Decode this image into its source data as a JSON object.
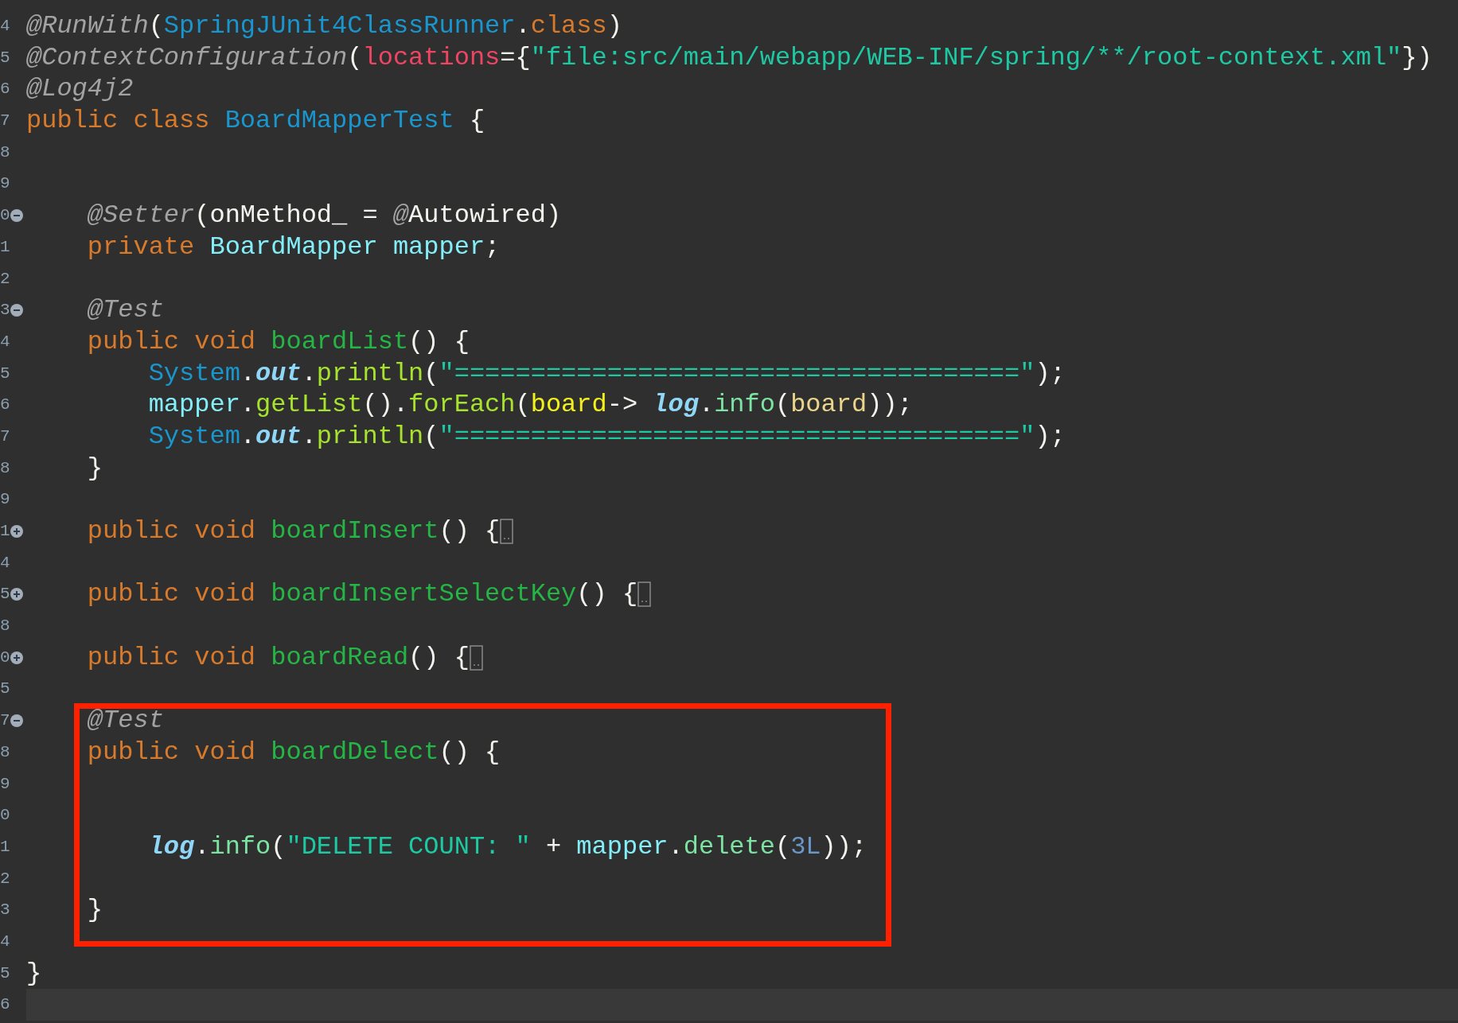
{
  "editor": {
    "sections": [
      {
        "kind": "plain",
        "lines": [
          {
            "number": "4",
            "tokens": [
              {
                "kind": "annotation",
                "text": "@RunWith"
              },
              {
                "kind": "plain",
                "text": "("
              },
              {
                "kind": "class",
                "text": "SpringJUnit4ClassRunner"
              },
              {
                "kind": "plain",
                "text": "."
              },
              {
                "kind": "keyword",
                "text": "class"
              },
              {
                "kind": "plain",
                "text": ")"
              }
            ]
          },
          {
            "number": "5",
            "tokens": [
              {
                "kind": "annotation",
                "text": "@ContextConfiguration"
              },
              {
                "kind": "plain",
                "text": "("
              },
              {
                "kind": "attribute",
                "text": "locations"
              },
              {
                "kind": "plain",
                "text": "={"
              },
              {
                "kind": "string",
                "text": "\"file:src/main/webapp/WEB-INF/spring/**/root-context.xml\""
              },
              {
                "kind": "plain",
                "text": "})"
              }
            ]
          },
          {
            "number": "6",
            "tokens": [
              {
                "kind": "annotation",
                "text": "@Log4j2"
              }
            ]
          },
          {
            "number": "7",
            "tokens": [
              {
                "kind": "keyword",
                "text": "public class "
              },
              {
                "kind": "class",
                "text": "BoardMapperTest "
              },
              {
                "kind": "plain",
                "text": "{"
              }
            ]
          },
          {
            "number": "8"
          },
          {
            "number": "9"
          },
          {
            "number": "0",
            "collapsed": false,
            "tokens": [
              {
                "kind": "annotation",
                "text": "    @Setter"
              },
              {
                "kind": "plain",
                "text": "(onMethod_ = "
              },
              {
                "kind": "annotation",
                "text": "@"
              },
              {
                "kind": "plain",
                "text": "Autowired)"
              }
            ]
          },
          {
            "number": "1",
            "tokens": [
              {
                "kind": "keyword",
                "text": "    private "
              },
              {
                "kind": "field",
                "text": "BoardMapper mapper"
              },
              {
                "kind": "plain",
                "text": ";"
              }
            ]
          },
          {
            "number": "2"
          },
          {
            "number": "3",
            "collapsed": false,
            "tokens": [
              {
                "kind": "annotation",
                "text": "    @Test"
              }
            ]
          },
          {
            "number": "4",
            "tokens": [
              {
                "kind": "keyword",
                "text": "    public void "
              },
              {
                "kind": "method",
                "text": "boardList"
              },
              {
                "kind": "plain",
                "text": "() {"
              }
            ]
          },
          {
            "number": "5",
            "tokens": [
              {
                "kind": "class",
                "text": "        System"
              },
              {
                "kind": "plain",
                "text": "."
              },
              {
                "kind": "static",
                "text": "out"
              },
              {
                "kind": "plain",
                "text": "."
              },
              {
                "kind": "call",
                "text": "println"
              },
              {
                "kind": "plain",
                "text": "("
              },
              {
                "kind": "string",
                "text": "\"=====================================\""
              },
              {
                "kind": "plain",
                "text": ");"
              }
            ]
          },
          {
            "number": "6",
            "tokens": [
              {
                "kind": "field",
                "text": "        mapper"
              },
              {
                "kind": "plain",
                "text": "."
              },
              {
                "kind": "call",
                "text": "getList"
              },
              {
                "kind": "plain",
                "text": "()."
              },
              {
                "kind": "call",
                "text": "forEach"
              },
              {
                "kind": "plain",
                "text": "("
              },
              {
                "kind": "parameter",
                "text": "board"
              },
              {
                "kind": "plain",
                "text": "-> "
              },
              {
                "kind": "static",
                "text": "log"
              },
              {
                "kind": "plain",
                "text": "."
              },
              {
                "kind": "member",
                "text": "info"
              },
              {
                "kind": "plain",
                "text": "("
              },
              {
                "kind": "argument",
                "text": "board"
              },
              {
                "kind": "plain",
                "text": "));"
              }
            ]
          },
          {
            "number": "7",
            "tokens": [
              {
                "kind": "class",
                "text": "        System"
              },
              {
                "kind": "plain",
                "text": "."
              },
              {
                "kind": "static",
                "text": "out"
              },
              {
                "kind": "plain",
                "text": "."
              },
              {
                "kind": "call",
                "text": "println"
              },
              {
                "kind": "plain",
                "text": "("
              },
              {
                "kind": "string",
                "text": "\"=====================================\""
              },
              {
                "kind": "plain",
                "text": ");"
              }
            ]
          },
          {
            "number": "8",
            "tokens": [
              {
                "kind": "plain",
                "text": "    }"
              }
            ]
          },
          {
            "number": "9"
          },
          {
            "number": "1",
            "collapsed": true,
            "tokens": [
              {
                "kind": "keyword",
                "text": "    public void "
              },
              {
                "kind": "method",
                "text": "boardInsert"
              },
              {
                "kind": "plain",
                "text": "() {"
              }
            ]
          },
          {
            "number": "4"
          },
          {
            "number": "5",
            "collapsed": true,
            "tokens": [
              {
                "kind": "keyword",
                "text": "    public void "
              },
              {
                "kind": "method",
                "text": "boardInsertSelectKey"
              },
              {
                "kind": "plain",
                "text": "() {"
              }
            ]
          },
          {
            "number": "8"
          },
          {
            "number": "0",
            "collapsed": true,
            "tokens": [
              {
                "kind": "keyword",
                "text": "    public void "
              },
              {
                "kind": "method",
                "text": "boardRead"
              },
              {
                "kind": "plain",
                "text": "() {"
              }
            ]
          },
          {
            "number": "5"
          }
        ]
      },
      {
        "kind": "highlight",
        "lines": [
          {
            "number": "7",
            "collapsed": false,
            "tokens": [
              {
                "kind": "annotation",
                "text": "    @Test"
              }
            ]
          },
          {
            "number": "8",
            "tokens": [
              {
                "kind": "keyword",
                "text": "    public void "
              },
              {
                "kind": "method",
                "text": "boardDelect"
              },
              {
                "kind": "plain",
                "text": "() {"
              }
            ]
          },
          {
            "number": "9"
          },
          {
            "number": "0"
          },
          {
            "number": "1",
            "tokens": [
              {
                "kind": "static",
                "text": "        log"
              },
              {
                "kind": "plain",
                "text": "."
              },
              {
                "kind": "member",
                "text": "info"
              },
              {
                "kind": "plain",
                "text": "("
              },
              {
                "kind": "string",
                "text": "\"DELETE COUNT: \""
              },
              {
                "kind": "plain",
                "text": " + "
              },
              {
                "kind": "field",
                "text": "mapper"
              },
              {
                "kind": "plain",
                "text": "."
              },
              {
                "kind": "member",
                "text": "delete"
              },
              {
                "kind": "plain",
                "text": "("
              },
              {
                "kind": "number",
                "text": "3L"
              },
              {
                "kind": "plain",
                "text": "));"
              }
            ]
          },
          {
            "number": "2"
          },
          {
            "number": "3",
            "tokens": [
              {
                "kind": "plain",
                "text": "    }"
              }
            ]
          }
        ]
      },
      {
        "kind": "plain",
        "lines": [
          {
            "number": "4"
          },
          {
            "number": "5",
            "tokens": [
              {
                "kind": "plain",
                "text": "}"
              }
            ]
          },
          {
            "number": "6",
            "current": true
          }
        ]
      }
    ]
  }
}
